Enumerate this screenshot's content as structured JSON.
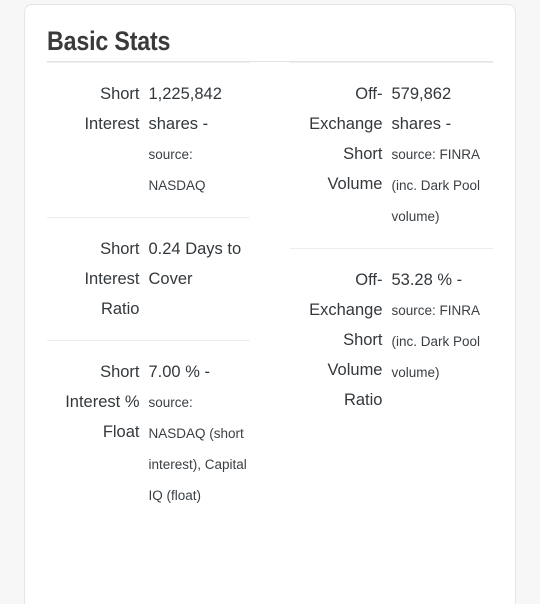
{
  "card": {
    "title": "Basic Stats"
  },
  "columns": [
    {
      "name": "left-column",
      "rows": [
        {
          "label": "Short Interest",
          "value_main": "1,225,842 shares -",
          "value_sub": "source: NASDAQ"
        },
        {
          "label": "Short Interest Ratio",
          "value_main": "0.24 Days to Cover",
          "value_sub": ""
        },
        {
          "label": "Short Interest % Float",
          "value_main": "7.00 % -",
          "value_sub": "source: NASDAQ (short interest), Capital IQ (float)"
        }
      ]
    },
    {
      "name": "right-column",
      "rows": [
        {
          "label": "Off-Exchange Short Volume",
          "value_main": "579,862 shares -",
          "value_sub": "source: FINRA (inc. Dark Pool volume)"
        },
        {
          "label": "Off-Exchange Short Volume Ratio",
          "value_main": "53.28 % -",
          "value_sub": "source: FINRA (inc. Dark Pool volume)"
        }
      ]
    }
  ],
  "colors": {
    "page_background": "#f7f7f7",
    "card_background": "#ffffff",
    "card_border": "#e6e6e6",
    "rule": "#ededed",
    "title_text": "#3a3a3a",
    "body_text": "#33383c"
  }
}
